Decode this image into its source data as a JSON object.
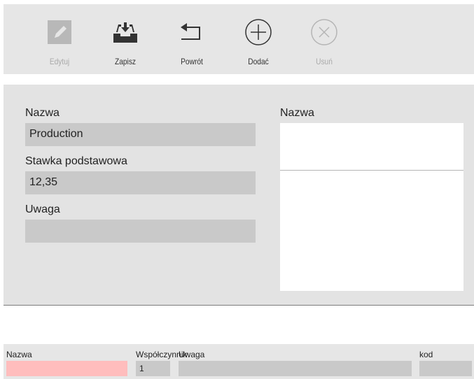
{
  "toolbar": {
    "edit_label": "Edytuj",
    "save_label": "Zapisz",
    "back_label": "Powrót",
    "add_label": "Dodać",
    "delete_label": "Usuń"
  },
  "form": {
    "name_label": "Nazwa",
    "name_value": "Production",
    "rate_label": "Stawka podstawowa",
    "rate_value": "12,35",
    "note_label": "Uwaga",
    "note_value": ""
  },
  "list": {
    "header_label": "Nazwa"
  },
  "grid": {
    "col_name": "Nazwa",
    "col_coef": "Współczynnik",
    "col_note": "Uwaga",
    "col_code": "kod",
    "row_name": "",
    "row_coef": "1",
    "row_note": "",
    "row_code": ""
  },
  "colors": {
    "accent_invalid": "#ffbdbd",
    "field_bg": "#c9c9c9",
    "panel_bg": "#e3e3e3"
  }
}
